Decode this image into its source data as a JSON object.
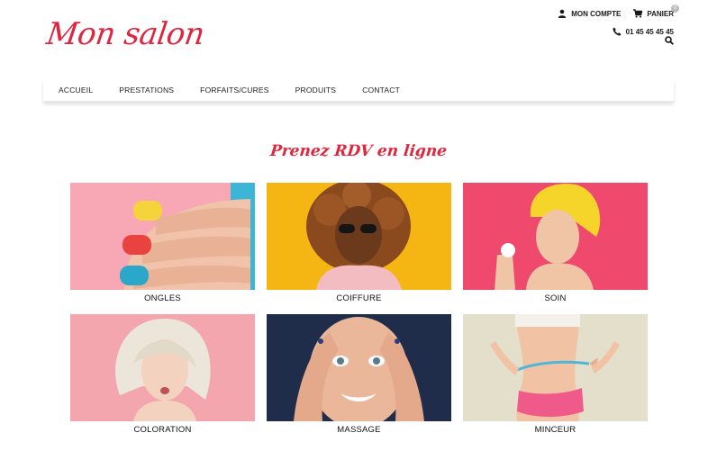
{
  "logo": {
    "text": "Mon salon"
  },
  "header": {
    "account_label": "MON COMPTE",
    "cart_label": "PANIER",
    "cart_count": "0",
    "phone": "01 45 45 45 45"
  },
  "nav": {
    "items": [
      {
        "label": "ACCUEIL"
      },
      {
        "label": "PRESTATIONS"
      },
      {
        "label": "FORFAITS/CURES"
      },
      {
        "label": "PRODUITS"
      },
      {
        "label": "CONTACT"
      }
    ]
  },
  "main": {
    "heading": "Prenez RDV en ligne",
    "services": [
      {
        "label": "ONGLES",
        "bg": "#f7a8b4"
      },
      {
        "label": "COIFFURE",
        "bg": "#f5b614"
      },
      {
        "label": "SOIN",
        "bg": "#ef4a6e"
      },
      {
        "label": "COLORATION",
        "bg": "#f4a6ae"
      },
      {
        "label": "MASSAGE",
        "bg": "#1f2d4a"
      },
      {
        "label": "MINCEUR",
        "bg": "#e4dfca"
      }
    ]
  },
  "colors": {
    "accent": "#e0253f"
  }
}
